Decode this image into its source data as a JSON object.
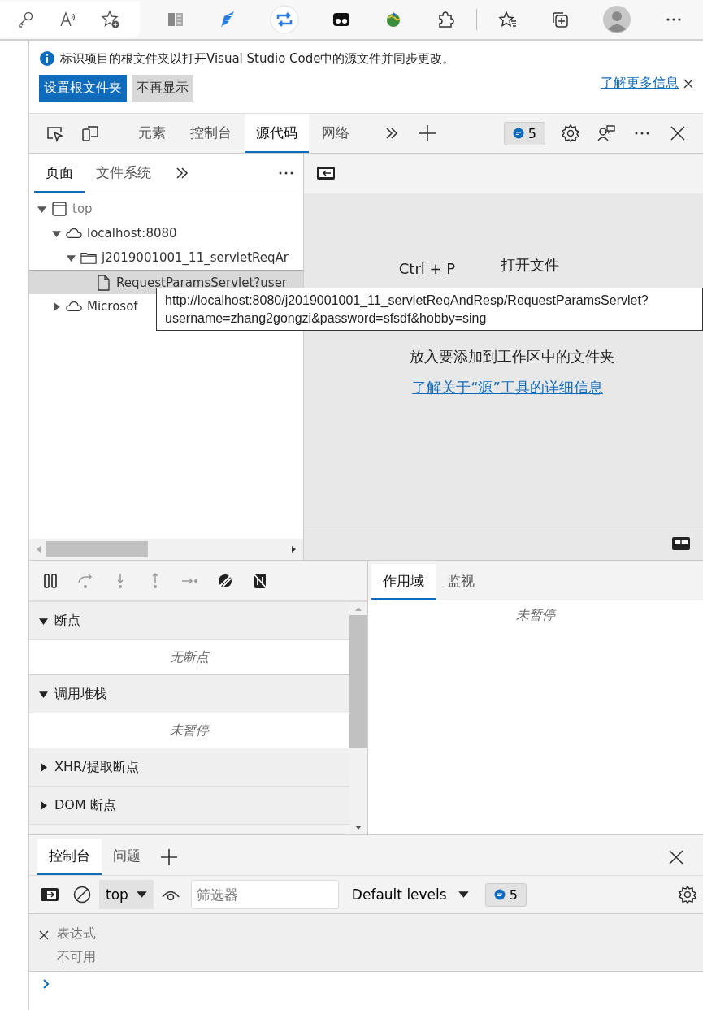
{
  "infobar": {
    "message": "标识项目的根文件夹以打开Visual Studio Code中的源文件并同步更改。",
    "buttons": [
      {
        "label": "设置根文件夹",
        "kind": "primary"
      },
      {
        "label": "不再显示",
        "kind": "secondary"
      }
    ],
    "link": "了解更多信息"
  },
  "devtools_tabs": [
    {
      "label": "元素",
      "selected": false
    },
    {
      "label": "控制台",
      "selected": false
    },
    {
      "label": "源代码",
      "selected": true
    },
    {
      "label": "网络",
      "selected": false
    }
  ],
  "issues_badge": "5",
  "navigator_tabs": [
    {
      "label": "页面",
      "selected": true
    },
    {
      "label": "文件系统",
      "selected": false
    }
  ],
  "tree": [
    {
      "label": "top",
      "kind": "frame",
      "expanded": true,
      "selected": false,
      "children": [
        {
          "label": "localhost:8080",
          "kind": "domain",
          "expanded": true,
          "selected": false,
          "children": [
            {
              "label": "j2019001001_11_servletReqAr",
              "kind": "folder",
              "expanded": true,
              "selected": false,
              "children": [
                {
                  "label": "RequestParamsServlet?user",
                  "kind": "file",
                  "selected": true
                }
              ]
            }
          ]
        },
        {
          "label": "Microsof",
          "kind": "domain",
          "expanded": false,
          "selected": false
        }
      ]
    }
  ],
  "editor": {
    "shortcut": "Ctrl + P",
    "action": "打开文件",
    "drop_hint": "放入要添加到工作区中的文件夹",
    "link": "了解关于“源”工具的详细信息"
  },
  "tooltip": {
    "lines": [
      "http://localhost:8080/j2019001001_11_servletReqAndResp/RequestParamsServlet?",
      "username=zhang2gongzi&password=sfsdf&hobby=sing"
    ]
  },
  "debugger_sections": [
    {
      "title": "断点",
      "expanded": true,
      "empty": "无断点"
    },
    {
      "title": "调用堆栈",
      "expanded": true,
      "empty": "未暂停"
    },
    {
      "title": "XHR/提取断点",
      "expanded": false
    },
    {
      "title": "DOM 断点",
      "expanded": false
    }
  ],
  "scope_tabs": [
    {
      "label": "作用域",
      "selected": true
    },
    {
      "label": "监视",
      "selected": false
    }
  ],
  "scope_message": "未暂停",
  "drawer_tabs": [
    {
      "label": "控制台",
      "selected": true
    },
    {
      "label": "问题",
      "selected": false
    }
  ],
  "console_toolbar": {
    "context": "top",
    "filter_placeholder": "筛选器",
    "levels": "Default levels",
    "badge": "5"
  },
  "expression": {
    "label": "表达式",
    "value": "不可用"
  }
}
